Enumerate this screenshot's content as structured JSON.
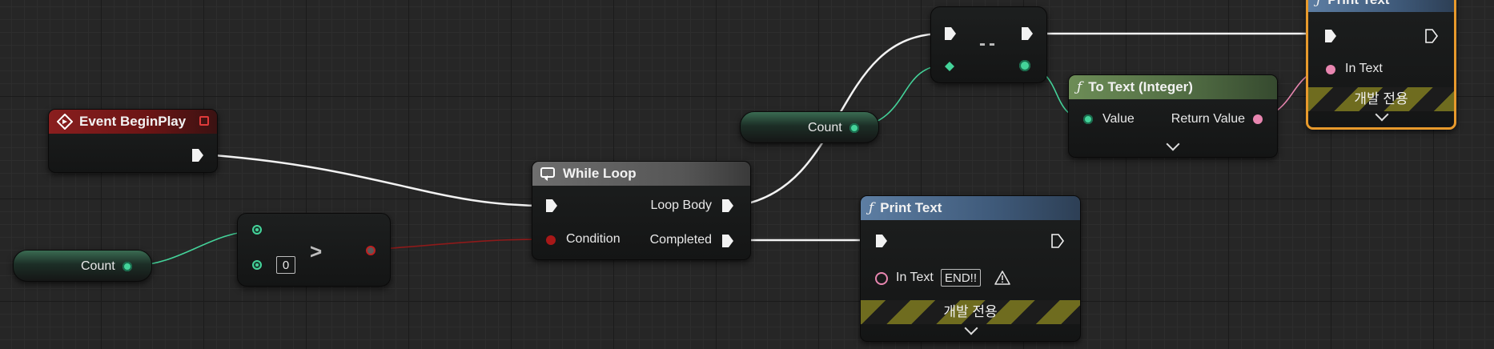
{
  "colors": {
    "exec_wire": "#f2f2f2",
    "int_wire": "#44d39a",
    "bool_wire": "#8e1a1a",
    "text_wire": "#e886b0",
    "selection": "#e89a2c"
  },
  "event_begin_play": {
    "title": "Event BeginPlay",
    "icon": "event-diamond-icon"
  },
  "count_var_1": {
    "label": "Count"
  },
  "count_var_2": {
    "label": "Count"
  },
  "greater_node": {
    "symbol": ">",
    "b_value": "0"
  },
  "while_loop": {
    "title": "While Loop",
    "icon": "loop-icon",
    "condition": "Condition",
    "loop_body": "Loop Body",
    "completed": "Completed"
  },
  "decrement_node": {
    "symbol": "--"
  },
  "to_text": {
    "title": "To Text (Integer)",
    "fn_symbol": "ƒ",
    "value": "Value",
    "return_value": "Return Value"
  },
  "print_text_1": {
    "title": "Print Text",
    "fn_symbol": "ƒ",
    "in_text": "In Text",
    "dev_only": "개발 전용"
  },
  "print_text_2": {
    "title": "Print Text",
    "fn_symbol": "ƒ",
    "in_text": "In Text",
    "in_text_value": "END!!",
    "dev_only": "개발 전용"
  }
}
